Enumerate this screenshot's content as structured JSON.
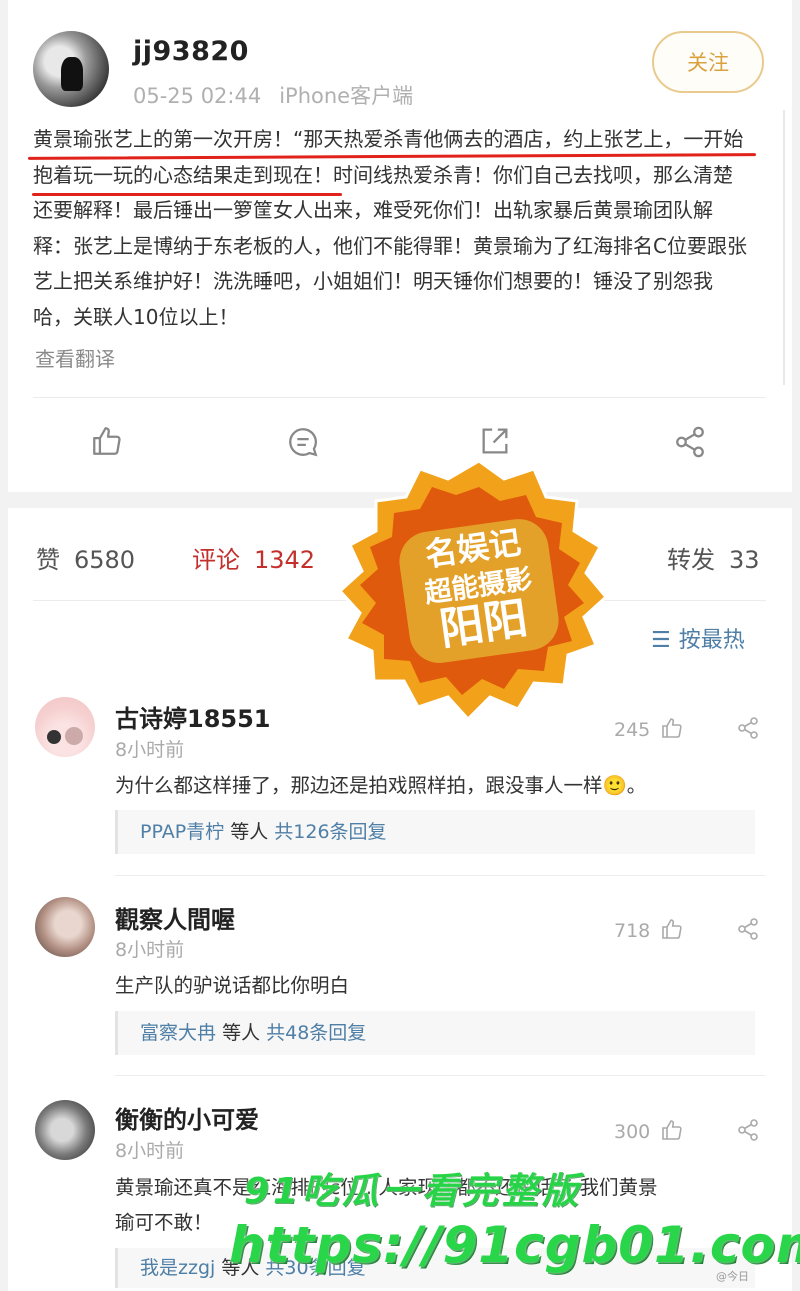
{
  "post": {
    "username": "jj93820",
    "date": "05-25 02:44",
    "client": "iPhone客户端",
    "follow_label": "关注",
    "lines": [
      "黄景瑜张艺上的第一次开房！“那天热爱杀青他俩去的酒店，约上张艺上，一开始",
      "抱着玩一玩的心态结果走到现在！时间线热爱杀青！你们自己去找呗，那么清楚",
      "还要解释！最后锤出一箩筐女人出来，难受死你们！出轨家暴后黄景瑜团队解",
      "释：张艺上是博纳于东老板的人，他们不能得罪！黄景瑜为了红海排名C位要跟张",
      "艺上把关系维护好！洗洗睡吧，小姐姐们！明天锤你们想要的！锤没了别怨我",
      "哈，关联人10位以上！"
    ],
    "translate_label": "查看翻译"
  },
  "actions": {
    "like_icon": "thumbs-up-icon",
    "comment_icon": "comment-icon",
    "repost_icon": "repost-icon",
    "share_icon": "share-icon"
  },
  "counts": {
    "likes_label": "赞",
    "likes": "6580",
    "comments_label": "评论",
    "comments": "1342",
    "reposts_label": "转发",
    "reposts": "33"
  },
  "sort": {
    "icon": "sort-icon",
    "label": "按最热"
  },
  "stamp": {
    "line1": "名娱记",
    "line2": "超能摄影",
    "line3": "阳阳"
  },
  "comments": [
    {
      "name": "古诗婷18551",
      "time": "8小时前",
      "text": "为什么都这样捶了，那边还是拍戏照样拍，跟没事人一样🙂。",
      "likes": "245",
      "reply_who": "PPAP青柠",
      "reply_mid": "等人",
      "reply_total": "共126条回复"
    },
    {
      "name": "觀察人間喔",
      "time": "8小时前",
      "text": "生产队的驴说话都比你明白",
      "likes": "718",
      "reply_who": "富察大冉",
      "reply_mid": "等人",
      "reply_total": "共48条回复"
    },
    {
      "name": "衡衡的小可爱",
      "time": "8小时前",
      "text_line1": "黄景瑜还真不是红海排的c位...人家现在都不还说话了.我们黄景",
      "text_line2": "瑜可不敢！",
      "likes": "300",
      "reply_who": "我是zzgj",
      "reply_mid": "等人",
      "reply_total": "共30条回复"
    }
  ],
  "watermark": {
    "line1": "91吃瓜一看完整版",
    "line2": "https://91cgb01.com",
    "corner": "@今日"
  },
  "colors": {
    "accent_red": "#c3302b",
    "link_blue": "#4f7fa6",
    "follow_gold": "#d9a23e",
    "watermark_green": "#2ad649"
  }
}
